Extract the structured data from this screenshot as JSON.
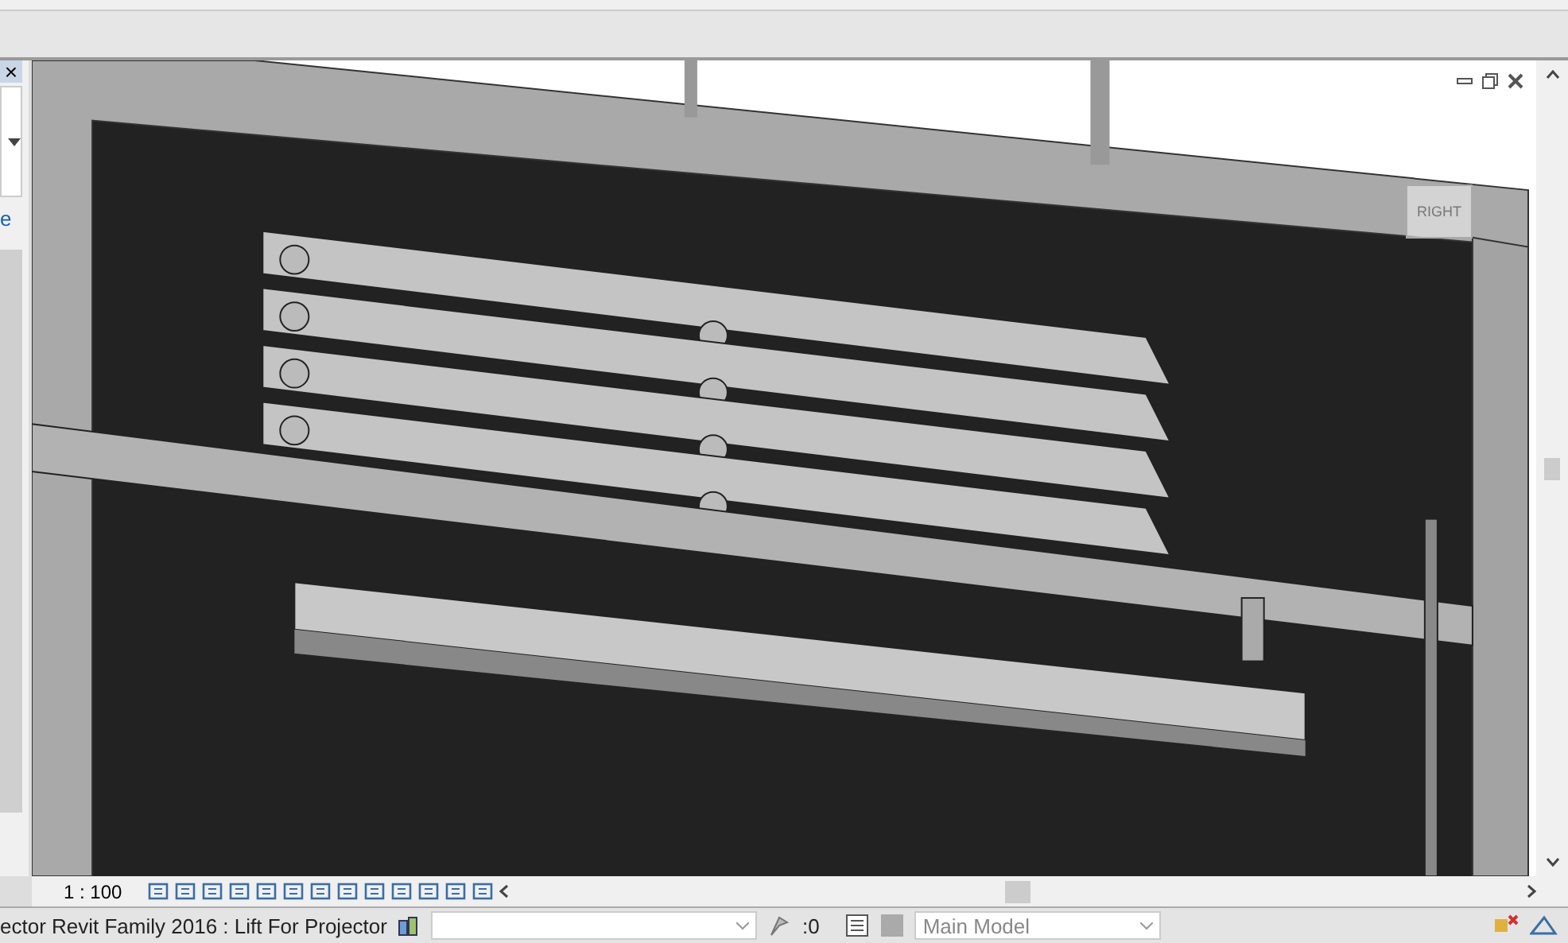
{
  "left_panel": {
    "close_glyph": "×",
    "text_fragment": "e"
  },
  "viewport": {
    "view_cube_label": "RIGHT"
  },
  "view_control_bar": {
    "scale": "1 : 100"
  },
  "status_bar": {
    "message": "ector Revit Family 2016 : Lift For Projector",
    "editing_requests": ":0",
    "workset": "Main Model"
  }
}
